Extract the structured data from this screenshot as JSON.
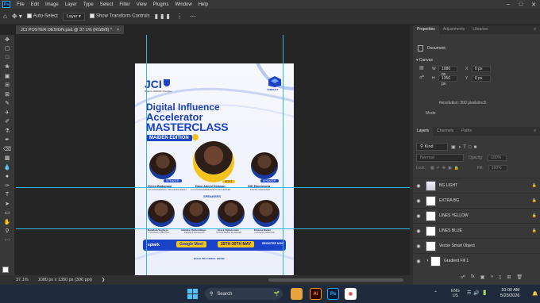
{
  "menubar": {
    "app_icon": "Ps",
    "items": [
      "File",
      "Edit",
      "Image",
      "Layer",
      "Type",
      "Select",
      "Filter",
      "View",
      "Plugins",
      "Window",
      "Help"
    ]
  },
  "options": {
    "auto_select_label": "Auto-Select",
    "auto_select_value": "Layer",
    "show_transform_label": "Show Transform Controls"
  },
  "document": {
    "tab_title": "JCI POSTER DESIGN.psd @ 37.1% (RGB/8) *",
    "close_glyph": "×"
  },
  "status": {
    "zoom": "37.1%",
    "doc_size": "1080 px x 1350 px (300 ppi)"
  },
  "poster": {
    "jci_logo": "JCI",
    "jci_sub": "Nigeria JUNIOR Chamber",
    "partner_logo": "JUMPLIFT",
    "title_line1": "Digital Influence",
    "title_line2": "Accelerator",
    "title_line3": "MASTERCLASS",
    "edition": "MAIDEN EDITION",
    "host_tag": "HOST",
    "speakers_label": "SPEAKERS",
    "top_people": [
      {
        "name": "Green Badamosi",
        "role": "CO-FOUNDER/CEO, INFLUENCE MEDIA",
        "tag": "SPEAKER"
      },
      {
        "name": "Dayo Ademi Dickson",
        "role": "CO-FOUNDER/PRESIDENT INFLUENCER",
        "tag": "HOST"
      },
      {
        "name": "Gift Ekpenyong",
        "role": "DIGITAL MARKETER",
        "tag": "SPEAKER"
      }
    ],
    "bottom_people": [
      {
        "name": "Damilola Segbeyo",
        "role": "CONTENT CREATOR"
      },
      {
        "name": "Adeleke Olufunmilayo",
        "role": "BRAND STRATEGIST"
      },
      {
        "name": "Grace Ogbuhomru",
        "role": "SOCIAL MEDIA MANAGER"
      },
      {
        "name": "Ebunna Banko",
        "role": "CONTENT CREATOR"
      }
    ],
    "footer_left": "splark",
    "footer_platform": "Google Meet",
    "footer_date": "25TH-30TH MAY",
    "footer_right": "REGISTER NOW",
    "bottom_note": "BUILD INFLUENCE. GROW."
  },
  "panels": {
    "top_tabs": [
      "Properties",
      "Adjustments",
      "Libraries"
    ],
    "document_label": "Document",
    "canvas_label": "Canvas",
    "width_label": "W",
    "width_value": "1080 px",
    "height_label": "H",
    "height_value": "1350 px",
    "x_label": "X",
    "x_value": "0 px",
    "y_label": "Y",
    "y_value": "0 px",
    "resolution": "Resolution: 300 pixels/inch",
    "mode_label": "Mode",
    "layer_tabs": [
      "Layers",
      "Channels",
      "Paths"
    ],
    "kind_label": "Kind",
    "blend_mode": "Normal",
    "opacity_label": "Opacity:",
    "opacity_value": "100%",
    "lock_label": "Lock:",
    "fill_label": "Fill:",
    "fill_value": "100%",
    "layers": [
      {
        "name": "BG LIGHT",
        "locked": true
      },
      {
        "name": "EXTRA BG",
        "locked": true
      },
      {
        "name": "LINES YELLOW",
        "locked": true
      },
      {
        "name": "LINES BLUE",
        "locked": true
      },
      {
        "name": "Vector Smart Object",
        "locked": false
      },
      {
        "name": "Gradient Fill 1",
        "locked": false
      }
    ]
  },
  "taskbar": {
    "search_placeholder": "Search",
    "lang_line1": "ENG",
    "lang_line2": "US",
    "time": "10:00 AM",
    "date": "5/23/2026"
  },
  "colors": {
    "accent_blue": "#31a8ff",
    "poster_blue": "#1b43c9",
    "poster_yellow": "#f3c21c",
    "guide": "#2fb9e0"
  }
}
